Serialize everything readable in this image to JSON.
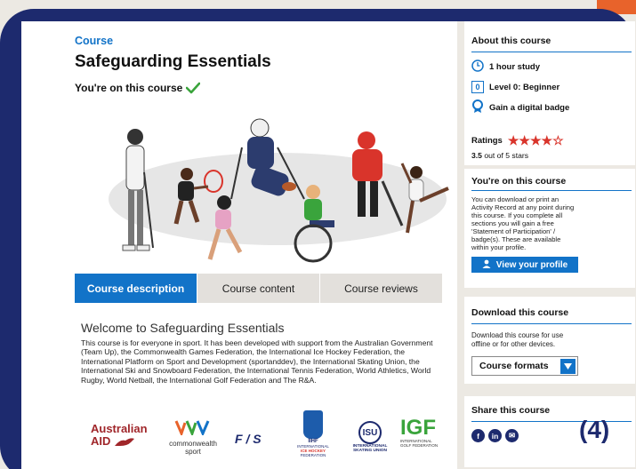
{
  "course": {
    "kicker": "Course",
    "title": "Safeguarding Essentials",
    "on_course": "You're on this course"
  },
  "tabs": [
    {
      "label": "Course description",
      "active": true
    },
    {
      "label": "Course content",
      "active": false
    },
    {
      "label": "Course reviews",
      "active": false
    }
  ],
  "description": {
    "heading": "Welcome to Safeguarding Essentials",
    "body": "This course is for everyone in sport. It has been developed with support from the Australian Government (Team Up), the Commonwealth Games Federation, the International Ice Hockey Federation, the International Platform on Sport and Development (sportanddev), the International Skating Union, the International Ski and Snowboard Federation, the International Tennis Federation, World Athletics, World Rugby, World Netball, the International Golf Federation and The R&A."
  },
  "logos": {
    "aus_line1": "Australian",
    "aus_line2": "AID",
    "cgf_line1": "commonwealth",
    "cgf_line2": "sport",
    "fis": "F / S",
    "iihf_top": "IIHF",
    "iihf_line1": "INTERNATIONAL",
    "iihf_line2": "ICE HOCKEY",
    "iihf_line3": "FEDERATION",
    "isu_mark": "ISU",
    "isu_line1": "INTERNATIONAL",
    "isu_line2": "SKATING UNION",
    "igf_mark": "IGF",
    "igf_line1": "INTERNATIONAL",
    "igf_line2": "GOLF FEDERATION"
  },
  "sidebar": {
    "about_title": "About this course",
    "study": "1 hour study",
    "level_num": "0",
    "level": "Level 0: Beginner",
    "badge": "Gain a digital badge",
    "ratings_label": "Ratings",
    "rating_value": 3.5,
    "rating_num": "3.5",
    "rating_suffix": "out of 5 stars",
    "oncourse_title": "You're on this course",
    "oncourse_text": "You can download or print an Activity Record at any point during this course. If you complete all sections you will gain a free 'Statement of Participation' / badge(s). These are available within your profile.",
    "profile_button": "View your profile",
    "download_title": "Download this course",
    "download_text": "Download this course for use offline or for other devices.",
    "formats_label": "Course formats",
    "share_title": "Share this course",
    "share_icons": [
      "f",
      "in",
      "✉"
    ]
  },
  "figure_label": "(4)",
  "colors": {
    "accent": "#1273c8",
    "frame": "#1d2a6e",
    "star": "#d9342b",
    "check": "#3aa43c"
  }
}
